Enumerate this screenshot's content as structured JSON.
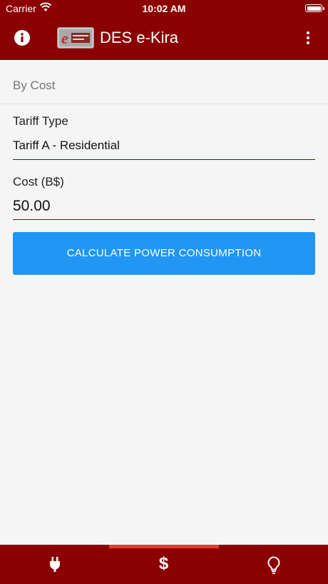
{
  "status_bar": {
    "carrier": "Carrier",
    "time": "10:02 AM"
  },
  "app_bar": {
    "title": "DES e-Kira",
    "color": "#8b0000"
  },
  "section": {
    "header": "By Cost"
  },
  "form": {
    "tariff": {
      "label": "Tariff Type",
      "value": "Tariff A - Residential"
    },
    "cost": {
      "label": "Cost (B$)",
      "value": "50.00"
    },
    "calculate_button": "CALCULATE POWER CONSUMPTION"
  },
  "bottom_nav": {
    "tabs": [
      {
        "icon": "plug-icon",
        "selected": false
      },
      {
        "icon": "dollar-icon",
        "label": "$",
        "selected": true
      },
      {
        "icon": "lightbulb-icon",
        "selected": false
      }
    ],
    "accent": "#e53935"
  },
  "colors": {
    "primary": "#8b0000",
    "button": "#2196f3",
    "background": "#f5f5f5"
  }
}
